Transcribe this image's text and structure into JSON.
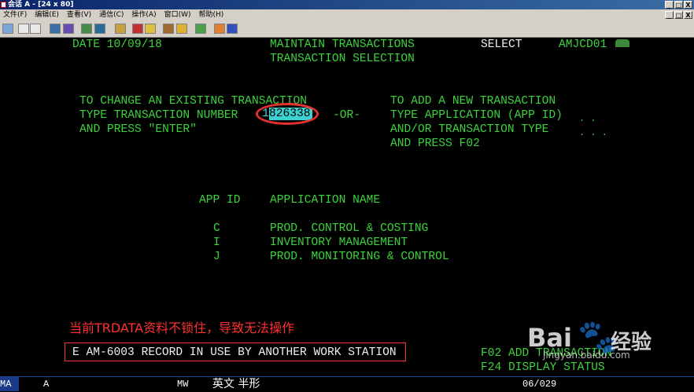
{
  "window": {
    "title": "会话 A - [24 x 80]",
    "buttons": [
      "_",
      "□",
      "X"
    ]
  },
  "menu": {
    "items": [
      "文件(F)",
      "编辑(E)",
      "查看(V)",
      "通信(C)",
      "操作(A)",
      "窗口(W)",
      "帮助(H)"
    ]
  },
  "screen": {
    "date_line": "DATE 10/09/18",
    "title1": "MAINTAIN TRANSACTIONS",
    "title2": "TRANSACTION SELECTION",
    "select_label": "SELECT",
    "screen_id": "AMJCD01",
    "left_l1": "TO CHANGE AN EXISTING TRANSACTION",
    "left_l2": "TYPE TRANSACTION NUMBER",
    "left_l3": "AND PRESS \"ENTER\"",
    "or_label": "-OR-",
    "right_l1": "TO ADD A NEW TRANSACTION",
    "right_l2": "TYPE APPLICATION (APP ID)",
    "right_l3": "AND/OR TRANSACTION TYPE",
    "right_l4": "AND PRESS F02",
    "app_id_dots": ". .",
    "trans_type_dots": ". . .",
    "transaction_number_first": "1",
    "transaction_number_rest": "826338",
    "col_app_id": "APP ID",
    "col_app_name": "APPLICATION NAME",
    "apps": [
      {
        "id": "C",
        "name": "PROD. CONTROL & COSTING"
      },
      {
        "id": "I",
        "name": "INVENTORY MANAGEMENT"
      },
      {
        "id": "J",
        "name": "PROD. MONITORING & CONTROL"
      }
    ],
    "error_message": "E AM-6003 RECORD IN USE BY ANOTHER WORK STATION",
    "fkey1": "F02 ADD TRANSACTION",
    "fkey2": "F24 DISPLAY STATUS"
  },
  "annotation": "当前TRDATA资料不锁住，导致无法操作",
  "watermark": {
    "brand": "Bai",
    "paw": "🐾",
    "cn": "经验",
    "url": "jingyan.baidu.com"
  },
  "status": {
    "ma": "MA",
    "a": "A",
    "mw": "MW",
    "ime": "英文 半形",
    "cursor_pos": "06/029"
  },
  "colors": {
    "terminal_green": "#3cd23c",
    "input_cyan": "#3cd2d2",
    "highlight_red": "#e53030"
  }
}
